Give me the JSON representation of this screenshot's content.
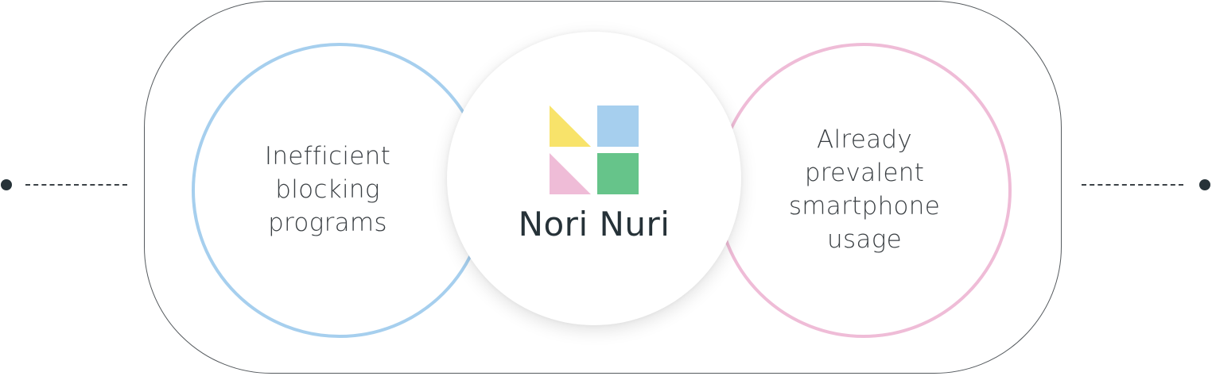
{
  "diagram": {
    "left_circle": {
      "text": "Inefficient\nblocking\nprograms",
      "border_color": "#a6cfee"
    },
    "right_circle": {
      "text": "Already\nprevalent\nsmartphone\nusage",
      "border_color": "#efbcd7"
    },
    "center": {
      "brand_name": "Nori Nuri",
      "logo_colors": {
        "yellow_triangle": "#f8e36a",
        "blue_square": "#a6cfee",
        "pink_triangle": "#efbcd7",
        "green_square": "#66c48a"
      }
    },
    "connector_color": "#263238",
    "frame_color": "#555a5e"
  }
}
